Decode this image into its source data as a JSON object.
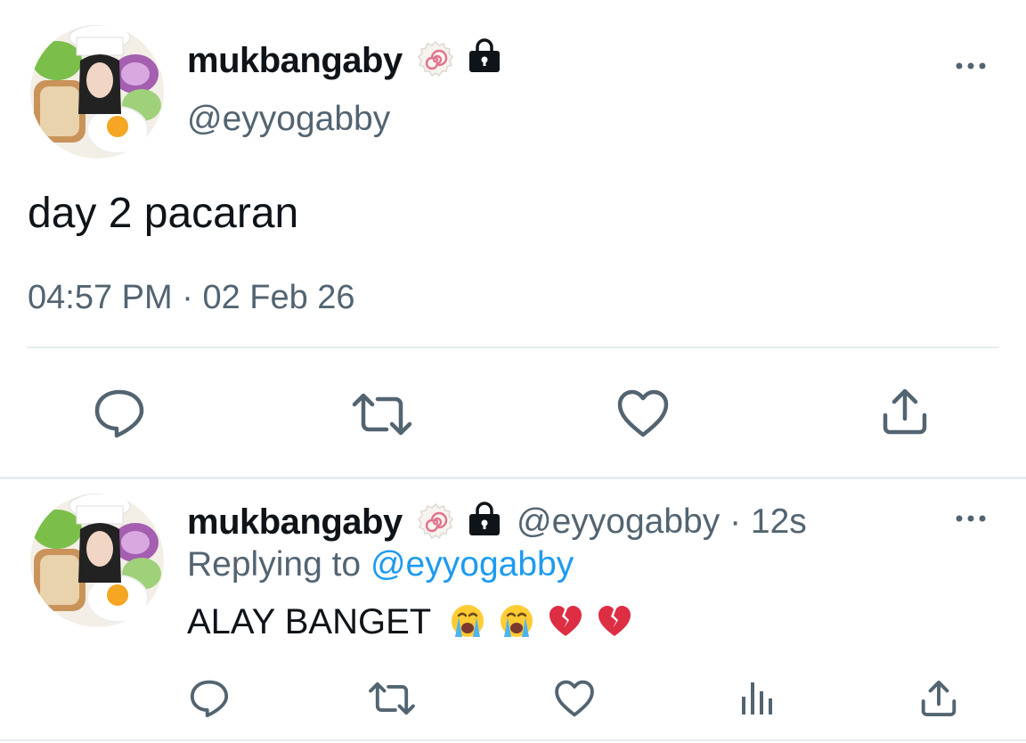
{
  "tweet": {
    "author": {
      "display_name": "mukbangaby",
      "handle": "@eyyogabby",
      "badge_icon": "fishcake-badge-icon",
      "lock_icon": "lock-icon"
    },
    "text": "day 2 pacaran",
    "timestamp": "04:57 PM",
    "separator": "·",
    "date": "02 Feb 26",
    "actions": [
      "reply-icon",
      "retweet-icon",
      "like-icon",
      "share-icon"
    ]
  },
  "reply": {
    "author": {
      "display_name": "mukbangaby",
      "handle": "@eyyogabby",
      "separator": "·",
      "time_ago": "12s"
    },
    "replying_prefix": "Replying to",
    "replying_handle": "@eyyogabby",
    "text": "ALAY BANGET",
    "emojis": [
      "loudly-crying-face",
      "loudly-crying-face",
      "broken-heart",
      "broken-heart"
    ],
    "actions": [
      "reply-icon",
      "retweet-icon",
      "like-icon",
      "analytics-icon",
      "share-icon"
    ]
  },
  "colors": {
    "text_primary": "#0f1419",
    "text_secondary": "#536471",
    "link": "#1d9bf0",
    "divider": "#e6ecf0"
  }
}
